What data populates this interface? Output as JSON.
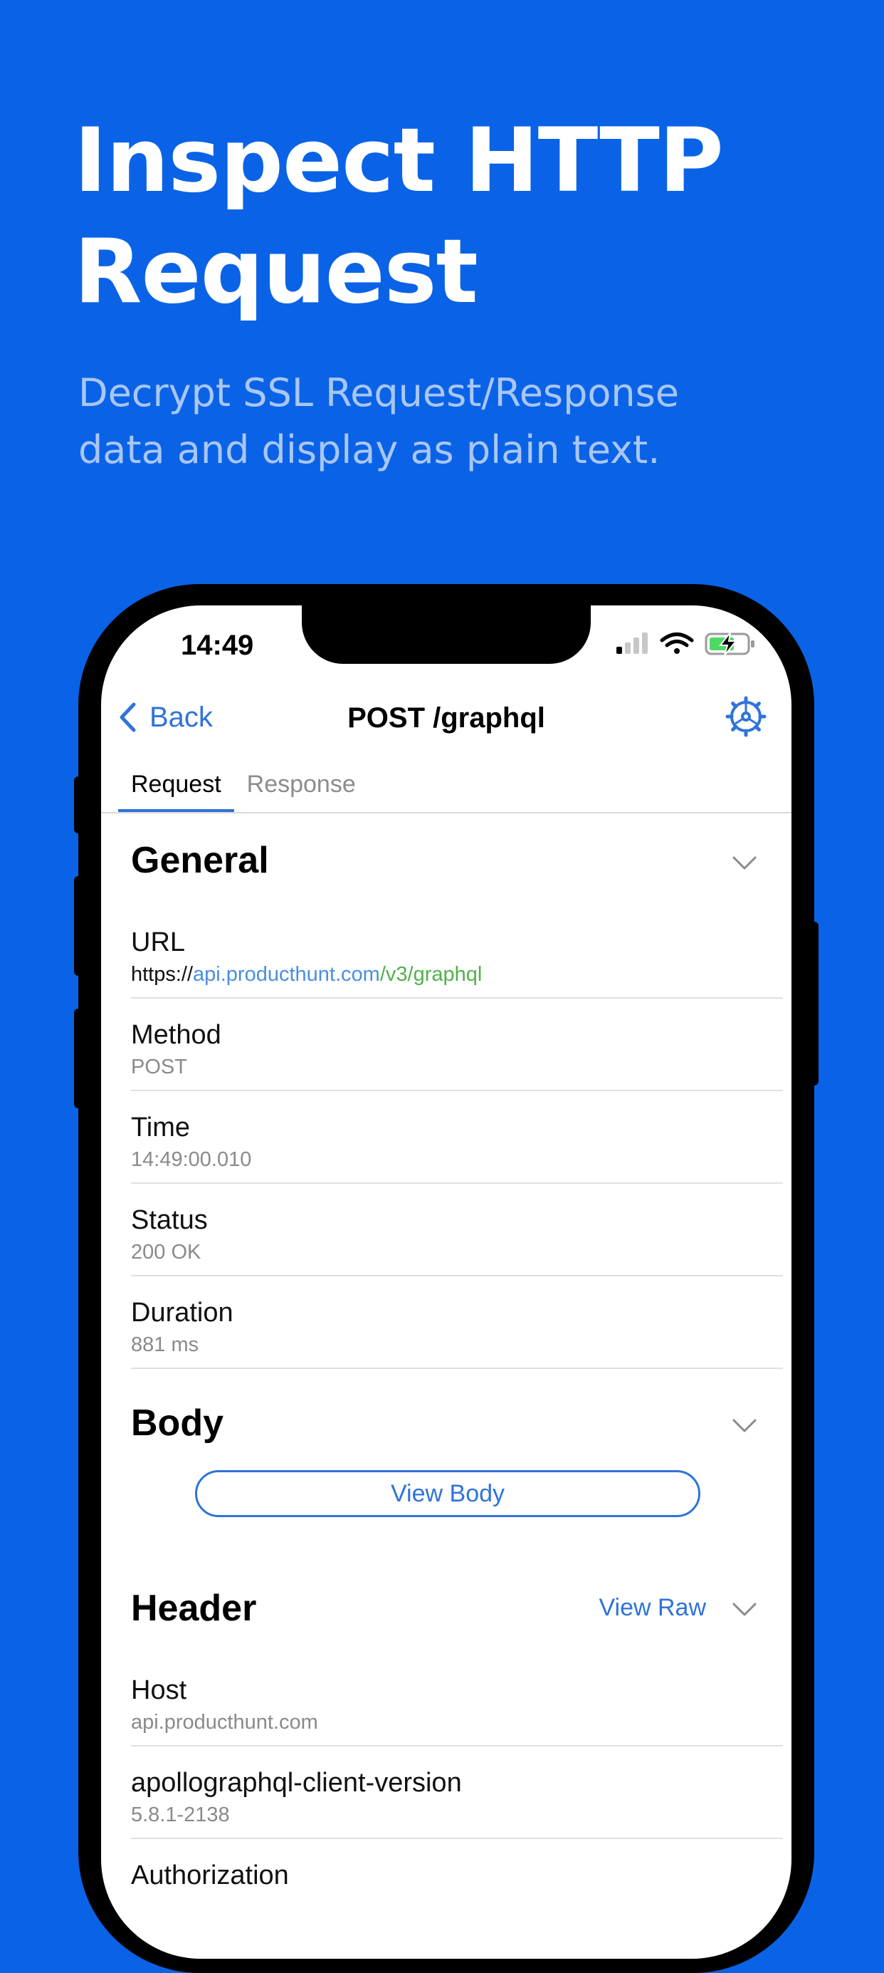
{
  "promo": {
    "headline_line1": "Inspect HTTP",
    "headline_line2": "Request",
    "subhead_line1": "Decrypt SSL Request/Response",
    "subhead_line2": "data and display as plain text."
  },
  "status_bar": {
    "time": "14:49",
    "icons": [
      "signal-icon",
      "wifi-icon",
      "battery-charging-icon"
    ]
  },
  "nav": {
    "back_label": "Back",
    "title": "POST /graphql",
    "settings_icon": "gear-icon"
  },
  "tabs": [
    {
      "label": "Request",
      "active": true
    },
    {
      "label": "Response",
      "active": false
    }
  ],
  "general": {
    "title": "General",
    "rows": [
      {
        "label": "URL",
        "value_scheme": "https://",
        "value_host": "api.producthunt.com",
        "value_path": "/v3/graphql"
      },
      {
        "label": "Method",
        "value": "POST"
      },
      {
        "label": "Time",
        "value": "14:49:00.010"
      },
      {
        "label": "Status",
        "value": "200 OK"
      },
      {
        "label": "Duration",
        "value": "881 ms"
      }
    ]
  },
  "body": {
    "title": "Body",
    "button_label": "View Body"
  },
  "header": {
    "title": "Header",
    "view_raw_label": "View Raw",
    "rows": [
      {
        "label": "Host",
        "value": "api.producthunt.com"
      },
      {
        "label": "apollographql-client-version",
        "value": "5.8.1-2138"
      },
      {
        "label": "Authorization",
        "value": ""
      }
    ]
  },
  "colors": {
    "background": "#0a63e6",
    "accent": "#2f73d9",
    "url_host": "#4a8fe0",
    "url_path": "#52b14a"
  }
}
